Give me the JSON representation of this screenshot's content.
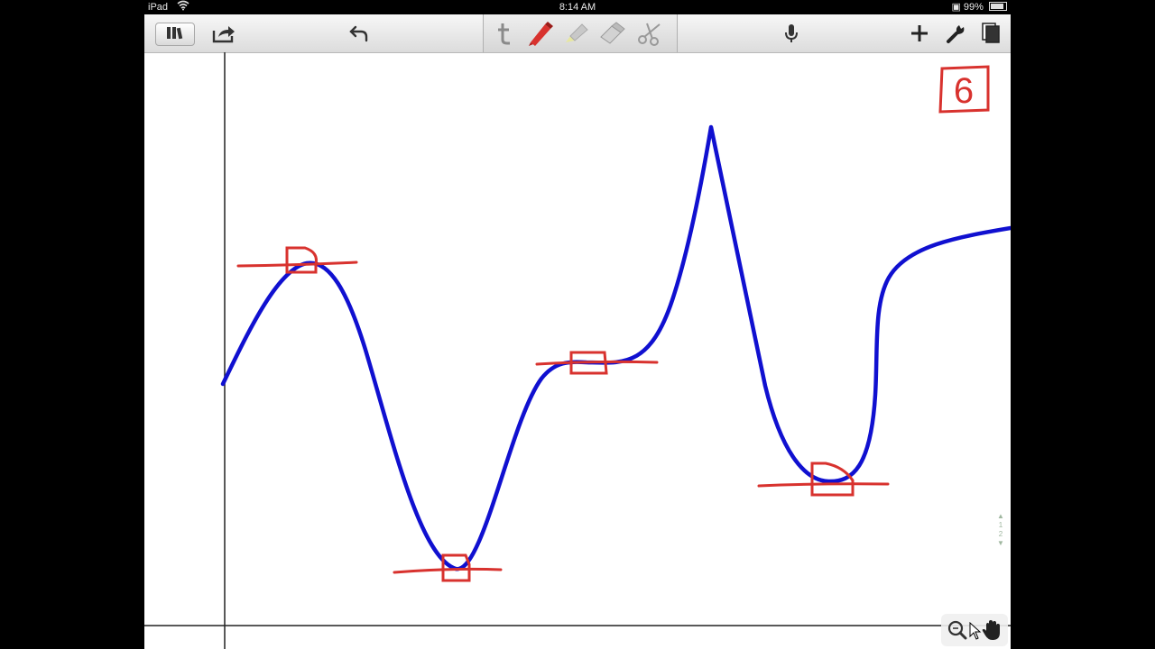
{
  "status_bar": {
    "carrier": "iPad",
    "time": "8:14 AM",
    "battery": "99%"
  },
  "toolbar": {
    "left_icons": [
      "library-icon",
      "share-icon",
      "undo-icon"
    ],
    "tool_icons": [
      "text-tool-icon",
      "pen-icon",
      "highlighter-icon",
      "eraser-icon",
      "scissors-icon"
    ],
    "right_icons": [
      "microphone-icon",
      "plus-icon",
      "wrench-icon",
      "pages-icon"
    ],
    "active_tool": "pen"
  },
  "annotation": {
    "page_number_mark": "6"
  },
  "page_indicator": {
    "pages": [
      "1",
      "2"
    ]
  },
  "bottom_tools": [
    "zoom-icon",
    "hand-icon"
  ],
  "colors": {
    "curve": "#1010d0",
    "ink": "#d8322e",
    "toolbar": "#e6e6e6",
    "axis": "#222222"
  }
}
